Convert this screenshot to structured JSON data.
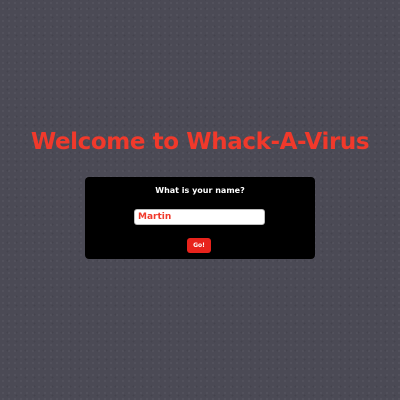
{
  "page": {
    "title": "Welcome to Whack-A-Virus"
  },
  "name_form": {
    "question": "What is your name?",
    "name_value": "Martin",
    "submit_label": "Go!"
  },
  "colors": {
    "background": "#4b4a55",
    "title": "#f0392b",
    "panel": "#000000",
    "input_text": "#f0392b",
    "button": "#e8231c",
    "button_text": "#ffffff"
  }
}
